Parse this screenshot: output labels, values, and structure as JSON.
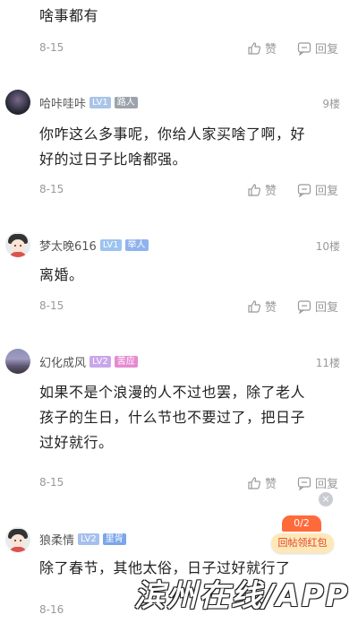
{
  "comments": [
    {
      "content": "啥事都有",
      "date": "8-15",
      "like_label": "赞",
      "reply_label": "回复"
    },
    {
      "user": "哈咔哇咔",
      "level": "LV1",
      "role": "路人",
      "floor": "9楼",
      "content_lines": [
        "你咋这么多事呢，你给人家买啥了啊，好",
        "好的过日子比啥都强。"
      ],
      "date": "8-15",
      "like_label": "赞",
      "reply_label": "回复"
    },
    {
      "user": "梦太晚616",
      "level": "LV1",
      "role": "举人",
      "floor": "10楼",
      "content": "离婚。",
      "date": "8-15",
      "like_label": "赞",
      "reply_label": "回复"
    },
    {
      "user": "幻化成风",
      "level": "LV2",
      "role": "苦应",
      "floor": "11楼",
      "content_lines": [
        "如果不是个浪漫的人不过也罢，除了老人",
        "孩子的生日，什么节也不要过了，把日子",
        "过好就行。"
      ],
      "date": "8-15",
      "like_label": "赞",
      "reply_label": "回复"
    },
    {
      "user": "狼柔情",
      "level": "LV2",
      "role": "里胥",
      "content": "除了春节，其他太俗，日子过好就行了",
      "date": "8-16"
    }
  ],
  "redpack": {
    "count": "0/2",
    "label": "回帖领红包"
  },
  "close_glyph": "×",
  "watermark": "滨州在线/APP",
  "colors": {
    "text": "#222222",
    "meta": "#999999",
    "redpack": "#ff6a3a"
  }
}
